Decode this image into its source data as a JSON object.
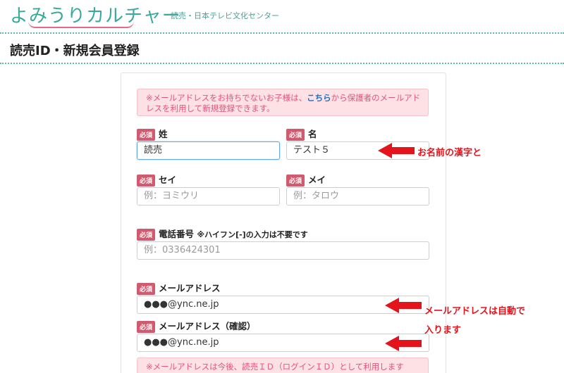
{
  "header": {
    "logo_text": "よみうりカルチャー",
    "logo_sub": "読売・日本テレビ文化センター"
  },
  "page_title": "読売ID・新規会員登録",
  "top_notice": {
    "prefix": "※メールアドレスをお持ちでないお子様は、",
    "link": "こちら",
    "suffix": "から保護者のメールアドレスを利用して新規登録できます。"
  },
  "required_badge": "必須",
  "fields": {
    "sei_label": "姓",
    "sei_value": "読売",
    "mei_label": "名",
    "mei_value": "テスト５",
    "sei_kana_label": "セイ",
    "sei_kana_placeholder": "例：ヨミウリ",
    "mei_kana_label": "メイ",
    "mei_kana_placeholder": "例：タロウ",
    "phone_label": "電話番号",
    "phone_note": "※ハイフン[-]の入力は不要です",
    "phone_placeholder": "例：0336424301",
    "email_label": "メールアドレス",
    "email_value": "●●●@ync.ne.jp",
    "email_confirm_label": "メールアドレス（確認）",
    "email_confirm_value": "●●●@ync.ne.jp"
  },
  "bottom_notice": "※メールアドレスは今後、読売ＩＤ（ログインＩＤ）として利用します",
  "annotations": {
    "name_callout": "お名前の漢字と",
    "email_callout_line1": "メールアドレスは自動で",
    "email_callout_line2": "入ります",
    "color": "#e3141b"
  }
}
